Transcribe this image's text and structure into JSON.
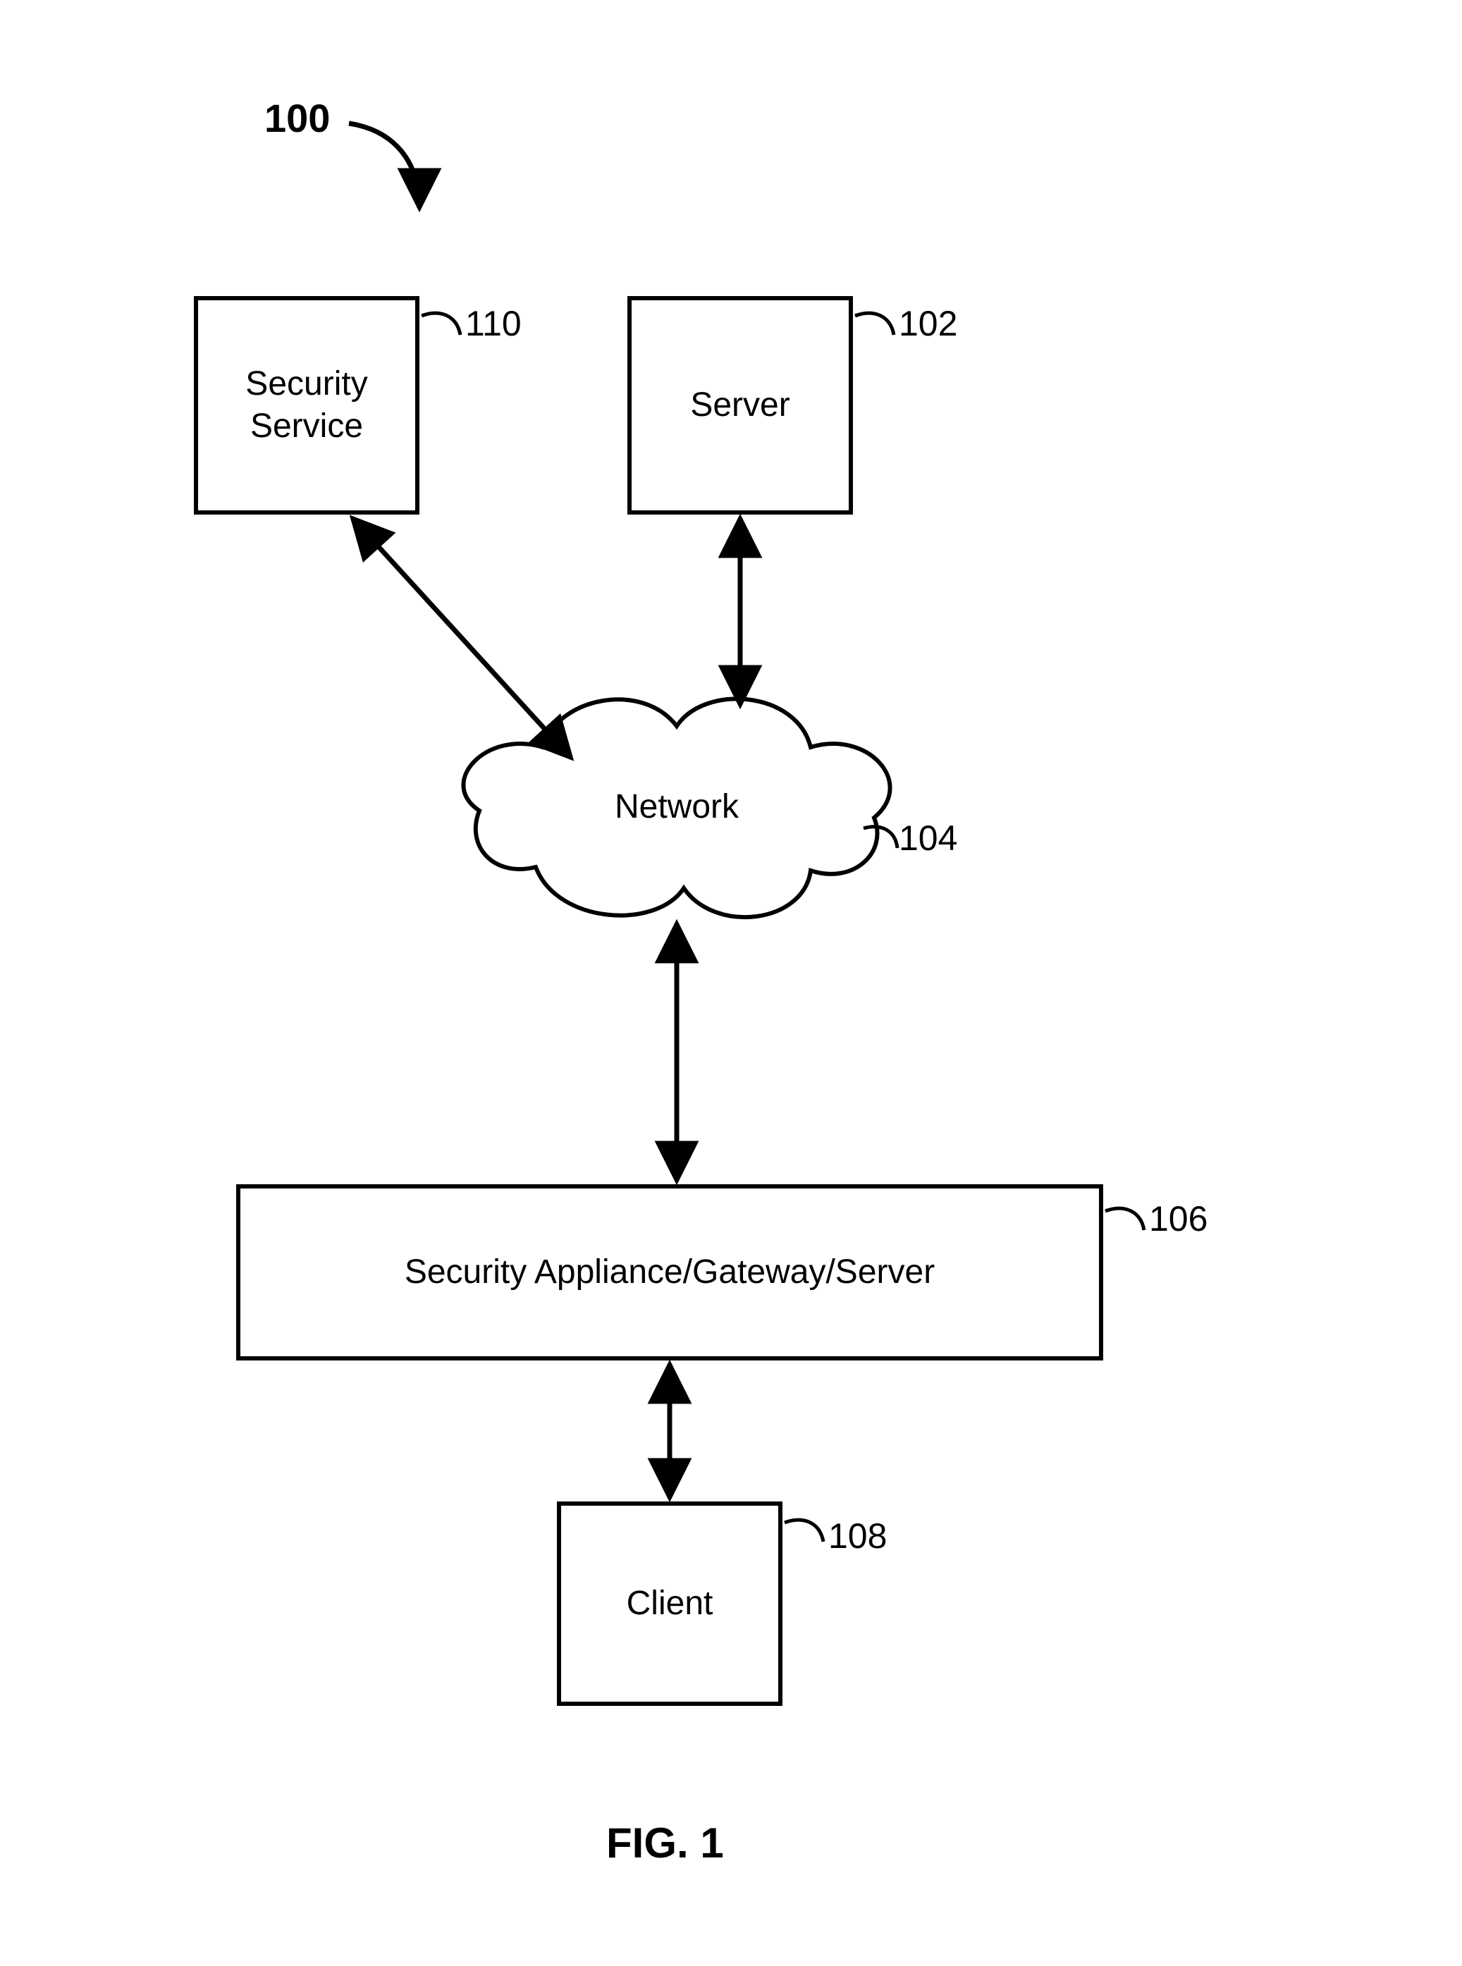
{
  "figure": {
    "ref_main": "100",
    "caption": "FIG. 1"
  },
  "nodes": {
    "security_service": {
      "label": "Security\nService",
      "ref": "110"
    },
    "server": {
      "label": "Server",
      "ref": "102"
    },
    "network": {
      "label": "Network",
      "ref": "104"
    },
    "gateway": {
      "label": "Security Appliance/Gateway/Server",
      "ref": "106"
    },
    "client": {
      "label": "Client",
      "ref": "108"
    }
  },
  "edges": [
    {
      "from": "security_service",
      "to": "network",
      "bidirectional": true
    },
    {
      "from": "server",
      "to": "network",
      "bidirectional": true
    },
    {
      "from": "network",
      "to": "gateway",
      "bidirectional": true
    },
    {
      "from": "gateway",
      "to": "client",
      "bidirectional": true
    }
  ]
}
